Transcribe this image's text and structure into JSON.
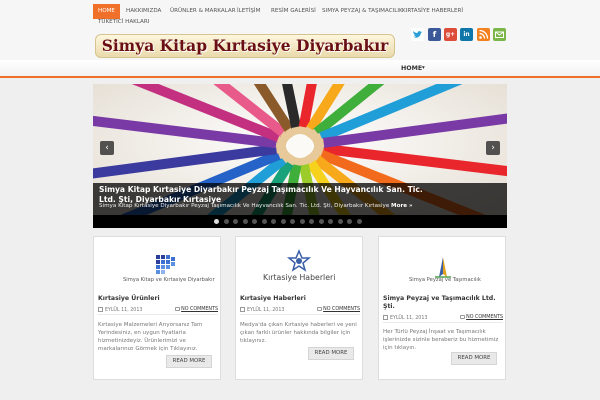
{
  "topnav": {
    "items": [
      "HOME",
      "HAKKIMIZDA",
      "ÜRÜNLER & MARKALAR",
      "İLETİŞİM",
      "RESİM GALERİSİ",
      "SIMYA PEYZAJ & TAŞIMACILIK",
      "KIRTASİYE HABERLERİ"
    ],
    "row2": "TÜKETİCİ HAKLARI"
  },
  "logo": "Simya Kitap Kırtasiye Diyarbakır",
  "social": [
    "twitter-icon",
    "facebook-icon",
    "google-plus-icon",
    "linkedin-icon",
    "rss-icon",
    "email-icon"
  ],
  "mainbar": {
    "home": "HOME",
    "arrow": "▾"
  },
  "slider": {
    "title": "Simya Kitap Kırtasiye Diyarbakır Peyzaj Taşımacılık Ve Hayvancılık San. Tic. Ltd. Şti, Diyarbakır Kırtasiye",
    "text": "Simya Kitap Kırtasiye Diyarbakır Peyzaj Taşımacılık Ve Hayvancılık San. Tic. Ltd. Şti, Diyarbakır Kırtasiye ",
    "more": "More »",
    "prev": "‹",
    "next": "›",
    "dots": 16,
    "active_dot": 0
  },
  "cards": [
    {
      "brand": "Simya Kitap ve Kırtasiye Diyarbakır",
      "title": "Kırtasiye Ürünleri",
      "date": "EYLÜL 11, 2013",
      "comments": "NO COMMENTS",
      "excerpt": "Kırtasiye Malzemeleri Arıyorsanız Tam Yerindesiniz, en uygun fiyatlarla hizmetinizdeyiz. Ürünlerimizi ve markalarınızı Görmek için Tıklayınız.",
      "more": "READ MORE"
    },
    {
      "brand": "Kırtasiye Haberleri",
      "title": "Kırtasiye Haberleri",
      "date": "EYLÜL 11, 2013",
      "comments": "NO COMMENTS",
      "excerpt": "Medya'da çıkan Kırtasiye haberleri ve yeni çıkan farklı ürünler hakkında bilgiler için tıklayınız.",
      "more": "READ MORE"
    },
    {
      "brand": "Simya Peyzaj ve Taşımacılık",
      "title": "Simya Peyzaj ve Taşımacılık Ltd. Şti.",
      "date": "EYLÜL 11, 2013",
      "comments": "NO COMMENTS",
      "excerpt": "Her Türlü Peyzaj İnşaat ve Taşımacılık işlerinizde sizinle beraberiz bu hizmetimiz için tıklayın.",
      "more": "READ MORE"
    }
  ],
  "colors": {
    "accent": "#f0702a",
    "logo_text": "#6a0f14"
  }
}
